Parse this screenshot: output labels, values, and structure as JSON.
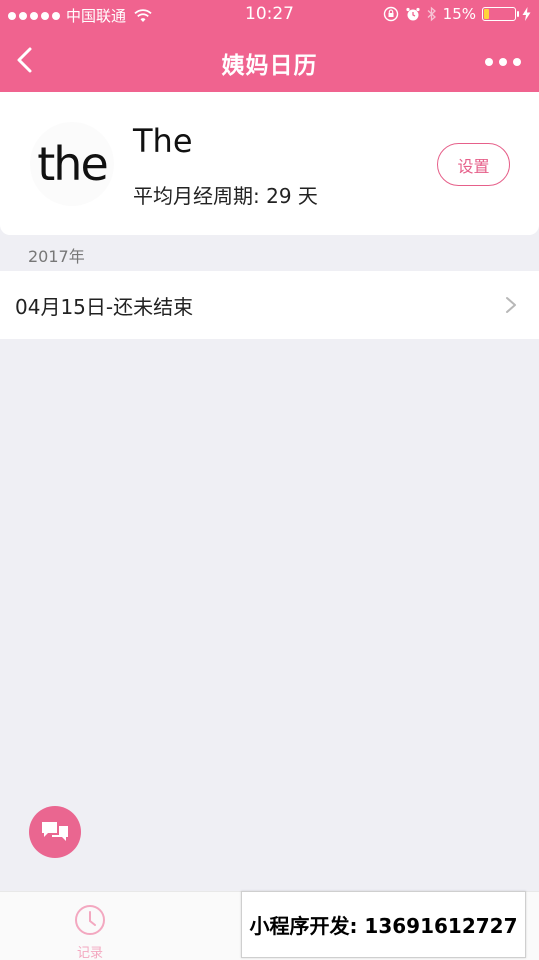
{
  "status_bar": {
    "carrier": "中国联通",
    "time": "10:27",
    "battery_percent": "15%",
    "battery_level": 0.15
  },
  "nav": {
    "title": "姨妈日历",
    "back_icon": "chevron-left-icon",
    "more_icon": "more-dots-icon"
  },
  "profile": {
    "avatar_text": "the",
    "name": "The",
    "cycle_label": "平均月经周期: 29 天",
    "settings_label": "设置"
  },
  "records": {
    "year": "2017年",
    "items": [
      {
        "label": "04月15日-还未结束"
      }
    ]
  },
  "tab_bar": {
    "items": [
      {
        "label": "记录",
        "icon": "clock-icon"
      }
    ]
  },
  "watermark": {
    "text": "小程序开发:  13691612727"
  },
  "colors": {
    "brand_pink": "#f0638f",
    "background": "#efeff4"
  }
}
